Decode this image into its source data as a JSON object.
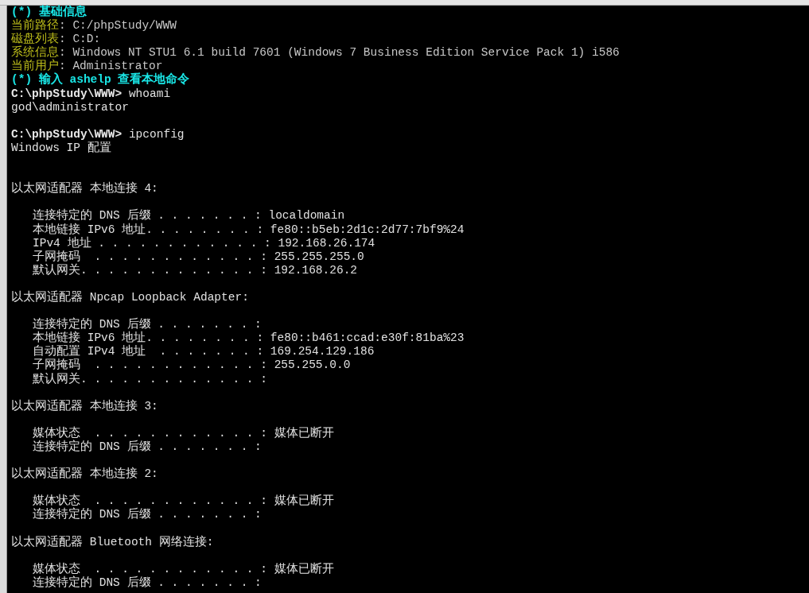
{
  "terminal": {
    "lines": [
      {
        "kind": "header",
        "text": "(*) 基础信息"
      },
      {
        "kind": "info",
        "label": "当前路径",
        "value": ": C:/phpStudy/WWW"
      },
      {
        "kind": "info",
        "label": "磁盘列表",
        "value": ": C:D:"
      },
      {
        "kind": "info",
        "label": "系统信息",
        "value": ": Windows NT STU1 6.1 build 7601 (Windows 7 Business Edition Service Pack 1) i586"
      },
      {
        "kind": "info",
        "label": "当前用户",
        "value": ": Administrator"
      },
      {
        "kind": "header",
        "text": "(*) 输入 ashelp 查看本地命令"
      },
      {
        "kind": "prompt",
        "prompt": "C:\\phpStudy\\WWW>",
        "command": "whoami"
      },
      {
        "kind": "output",
        "text": "god\\administrator"
      },
      {
        "kind": "blank"
      },
      {
        "kind": "prompt",
        "prompt": "C:\\phpStudy\\WWW>",
        "command": "ipconfig"
      },
      {
        "kind": "output",
        "text": "Windows IP 配置"
      },
      {
        "kind": "blank"
      },
      {
        "kind": "blank"
      },
      {
        "kind": "output",
        "text": "以太网适配器 本地连接 4:"
      },
      {
        "kind": "blank"
      },
      {
        "kind": "entry",
        "text": "连接特定的 DNS 后缀 . . . . . . . : localdomain"
      },
      {
        "kind": "entry",
        "text": "本地链接 IPv6 地址. . . . . . . . : fe80::b5eb:2d1c:2d77:7bf9%24"
      },
      {
        "kind": "entry",
        "text": "IPv4 地址 . . . . . . . . . . . . : 192.168.26.174"
      },
      {
        "kind": "entry",
        "text": "子网掩码  . . . . . . . . . . . . : 255.255.255.0"
      },
      {
        "kind": "entry",
        "text": "默认网关. . . . . . . . . . . . . : 192.168.26.2"
      },
      {
        "kind": "blank"
      },
      {
        "kind": "output",
        "text": "以太网适配器 Npcap Loopback Adapter:"
      },
      {
        "kind": "blank"
      },
      {
        "kind": "entry",
        "text": "连接特定的 DNS 后缀 . . . . . . . :"
      },
      {
        "kind": "entry",
        "text": "本地链接 IPv6 地址. . . . . . . . : fe80::b461:ccad:e30f:81ba%23"
      },
      {
        "kind": "entry",
        "text": "自动配置 IPv4 地址  . . . . . . . : 169.254.129.186"
      },
      {
        "kind": "entry",
        "text": "子网掩码  . . . . . . . . . . . . : 255.255.0.0"
      },
      {
        "kind": "entry",
        "text": "默认网关. . . . . . . . . . . . . :"
      },
      {
        "kind": "blank"
      },
      {
        "kind": "output",
        "text": "以太网适配器 本地连接 3:"
      },
      {
        "kind": "blank"
      },
      {
        "kind": "entry",
        "text": "媒体状态  . . . . . . . . . . . . : 媒体已断开"
      },
      {
        "kind": "entry",
        "text": "连接特定的 DNS 后缀 . . . . . . . :"
      },
      {
        "kind": "blank"
      },
      {
        "kind": "output",
        "text": "以太网适配器 本地连接 2:"
      },
      {
        "kind": "blank"
      },
      {
        "kind": "entry",
        "text": "媒体状态  . . . . . . . . . . . . : 媒体已断开"
      },
      {
        "kind": "entry",
        "text": "连接特定的 DNS 后缀 . . . . . . . :"
      },
      {
        "kind": "blank"
      },
      {
        "kind": "output",
        "text": "以太网适配器 Bluetooth 网络连接:"
      },
      {
        "kind": "blank"
      },
      {
        "kind": "entry",
        "text": "媒体状态  . . . . . . . . . . . . : 媒体已断开"
      },
      {
        "kind": "entry",
        "text": "连接特定的 DNS 后缀 . . . . . . . :"
      }
    ]
  }
}
